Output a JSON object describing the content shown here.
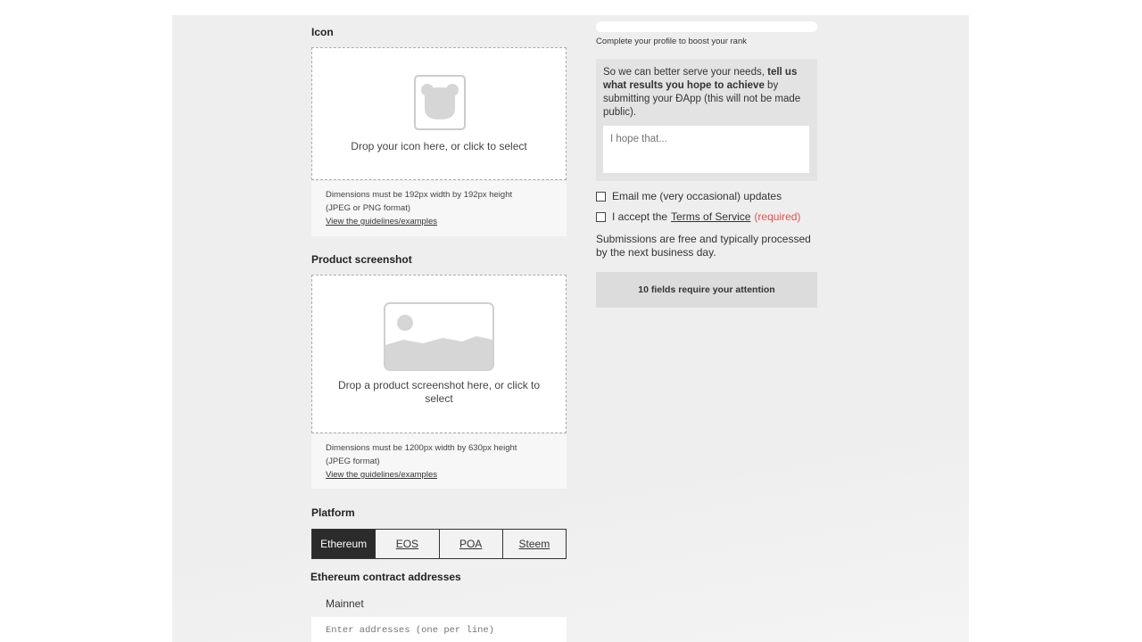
{
  "icon_section": {
    "label": "Icon",
    "drop_caption": "Drop your icon here, or click to select",
    "icon": "bear-head-icon",
    "help_line1": "Dimensions must be 192px width by 192px height",
    "help_line2": "(JPEG or PNG format)",
    "help_link": "View the guidelines/examples"
  },
  "screenshot_section": {
    "label": "Product screenshot",
    "drop_caption": "Drop a product screenshot here, or click to select",
    "icon": "image-placeholder-icon",
    "help_line1": "Dimensions must be 1200px width by 630px height",
    "help_line2": "(JPEG format)",
    "help_link": "View the guidelines/examples"
  },
  "platform": {
    "label": "Platform",
    "options": [
      "Ethereum",
      "EOS",
      "POA",
      "Steem"
    ],
    "selected": "Ethereum"
  },
  "contracts": {
    "label": "Ethereum contract addresses",
    "network": "Mainnet",
    "placeholder": "Enter addresses (one per line)"
  },
  "profile": {
    "progress_caption": "Complete your profile to boost your rank"
  },
  "feedback": {
    "text_before": "So we can better serve your needs, ",
    "text_bold": "tell us what results you hope to achieve",
    "text_after": " by submitting your ÐApp (this will not be made public).",
    "placeholder": "I hope that..."
  },
  "consent": {
    "email_label": "Email me (very occasional) updates",
    "tos_prefix": "I accept the",
    "tos_link": "Terms of Service",
    "tos_required": "(required)"
  },
  "note": "Submissions are free and typically processed by the next business day.",
  "submit": {
    "label": "10 fields require your attention"
  },
  "colors": {
    "active_segment": "#2b2b2b",
    "required": "#e0524f",
    "panel": "#eeeeee"
  }
}
